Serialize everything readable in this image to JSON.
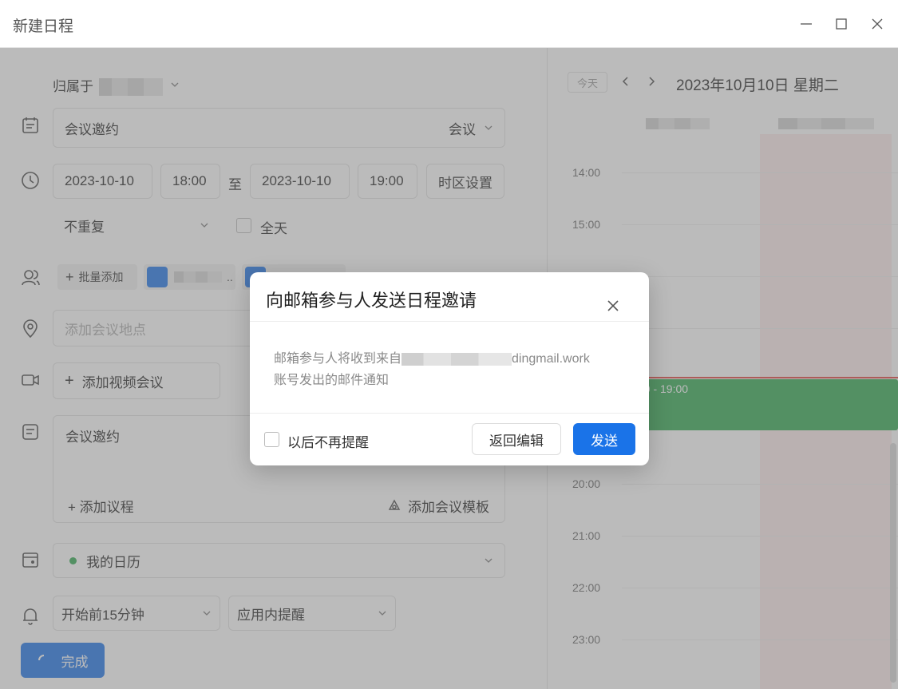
{
  "window": {
    "title": "新建日程"
  },
  "form": {
    "owner_label": "归属于",
    "subject": "会议邀约",
    "type": "会议",
    "start_date": "2023-10-10",
    "start_time": "18:00",
    "to": "至",
    "end_date": "2023-10-10",
    "end_time": "19:00",
    "timezone": "时区设置",
    "repeat": "不重复",
    "all_day": "全天",
    "batch_add": "批量添加",
    "participant_more": "..",
    "location_placeholder": "添加会议地点",
    "video": "添加视频会议",
    "desc": "会议邀约",
    "add_agenda": "添加议程",
    "add_template": "添加会议模板",
    "calendar": "我的日历",
    "reminder_time": "开始前15分钟",
    "reminder_type": "应用内提醒",
    "done": "完成"
  },
  "calendar": {
    "today": "今天",
    "date": "2023年10月10日 星期二",
    "hours": [
      "14:00",
      "15:00",
      "20:00",
      "21:00",
      "22:00",
      "23:00"
    ],
    "event_time": "00 - 19:00"
  },
  "modal": {
    "title": "向邮箱参与人发送日程邀请",
    "body_line1_suffix": "dingmail.work",
    "body_prefix": "邮箱参与人将收到来自",
    "body_line2": "账号发出的邮件通知",
    "checkbox": "以后不再提醒",
    "back": "返回编辑",
    "send": "发送"
  },
  "colors": {
    "primary": "#1a73e8",
    "event": "#2ea84f",
    "today_bg": "#fdeaea"
  }
}
